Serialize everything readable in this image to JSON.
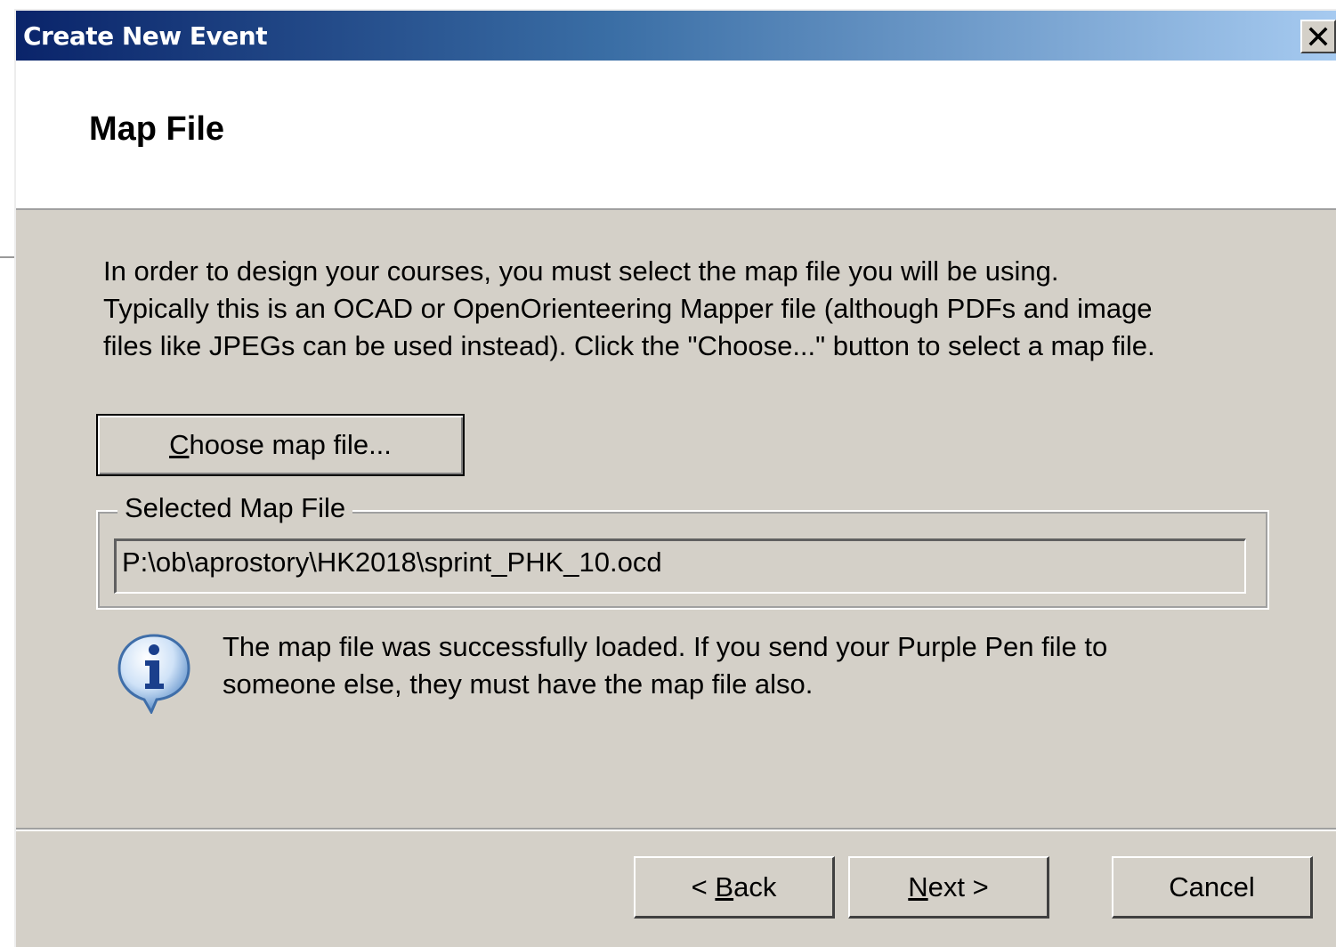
{
  "window": {
    "title": "Create New Event",
    "close_icon": "close-icon"
  },
  "header": {
    "title": "Map File"
  },
  "description": {
    "line1": "In order to design your courses, you must select the map file you will be using.",
    "line2": "Typically this is an OCAD or OpenOrienteering Mapper file (although PDFs and image",
    "line3": "files like JPEGs can be used instead). Click the \"Choose...\" button to select a map file."
  },
  "choose_button": {
    "mnemonic": "C",
    "rest": "hoose map file..."
  },
  "selected_map": {
    "legend": "Selected Map File",
    "path": "P:\\ob\\aprostory\\HK2018\\sprint_PHK_10.ocd"
  },
  "info": {
    "icon": "info-icon",
    "line1": "The map file was successfully loaded. If you send your Purple Pen file to",
    "line2": "someone else, they must have the map file also."
  },
  "buttons": {
    "back_prefix": "< ",
    "back_mnemonic": "B",
    "back_rest": "ack",
    "next_mnemonic": "N",
    "next_rest": "ext >",
    "cancel": "Cancel"
  },
  "colors": {
    "dialog_bg": "#d4d0c8",
    "titlebar_start": "#0a246a",
    "titlebar_end": "#a6caf0"
  }
}
